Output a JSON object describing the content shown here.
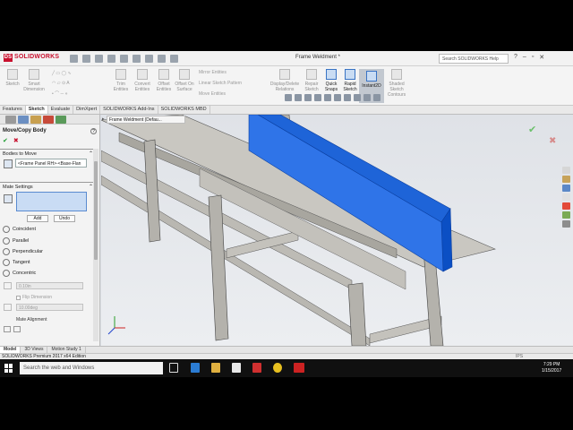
{
  "app": {
    "logo": "SOLIDWORKS",
    "document_title": "Frame Weldment *",
    "help_search_placeholder": "Search SOLIDWORKS Help"
  },
  "ribbon": {
    "buttons": [
      {
        "label": "Sketch",
        "icon": "sketch-icon"
      },
      {
        "label": "Smart Dimension",
        "icon": "smart-dimension-icon"
      },
      {
        "label": "Trim Entities",
        "icon": "trim-icon"
      },
      {
        "label": "Convert Entities",
        "icon": "convert-icon"
      },
      {
        "label": "Offset Entities",
        "icon": "offset-icon"
      },
      {
        "label": "Offset On Surface",
        "icon": "offset-surface-icon"
      },
      {
        "label": "Display/Delete Relations",
        "icon": "relations-icon"
      },
      {
        "label": "Repair Sketch",
        "icon": "repair-icon"
      },
      {
        "label": "Quick Snaps",
        "icon": "snap-icon"
      },
      {
        "label": "Rapid Sketch",
        "icon": "rapid-sketch-icon"
      },
      {
        "label": "Instant2D",
        "icon": "instant2d-icon"
      },
      {
        "label": "Shaded Sketch Contours",
        "icon": "shaded-contours-icon"
      }
    ],
    "small": {
      "mirror": "Mirror Entities",
      "pattern": "Linear Sketch Pattern",
      "move": "Move Entities"
    }
  },
  "tabs": [
    "Features",
    "Sketch",
    "Evaluate",
    "DimXpert",
    "SOLIDWORKS Add-Ins",
    "SOLIDWORKS MBD"
  ],
  "active_tab": "Sketch",
  "feature_tree_flyout": "Frame Weldment (Defau...",
  "property_manager": {
    "title": "Move/Copy Body",
    "bodies_to_move_label": "Bodies to Move",
    "bodies_value": "<Frame Panel RH>-<Base-Flan",
    "mate_settings_label": "Mate Settings",
    "add_label": "Add",
    "undo_label": "Undo",
    "mates": [
      "Coincident",
      "Parallel",
      "Perpendicular",
      "Tangent",
      "Concentric"
    ],
    "distance_value": "0.10in",
    "flip_dimension_label": "Flip Dimension",
    "angle_value": "10.00deg",
    "mate_alignment_label": "Mate Alignment"
  },
  "bottom_tabs": [
    "Model",
    "3D Views",
    "Motion Study 1"
  ],
  "status_text": "SOLIDWORKS Premium 2017 x64 Edition",
  "status_units": "IPS",
  "taskbar": {
    "search_placeholder": "Search the web and Windows",
    "time": "7:29 PM",
    "date": "1/15/2017"
  },
  "colors": {
    "selection_beam": "#1e64d8",
    "frame_gray": "#b4b2ac",
    "brand_red": "#c8102e",
    "ok_green": "#1a9b2e"
  }
}
